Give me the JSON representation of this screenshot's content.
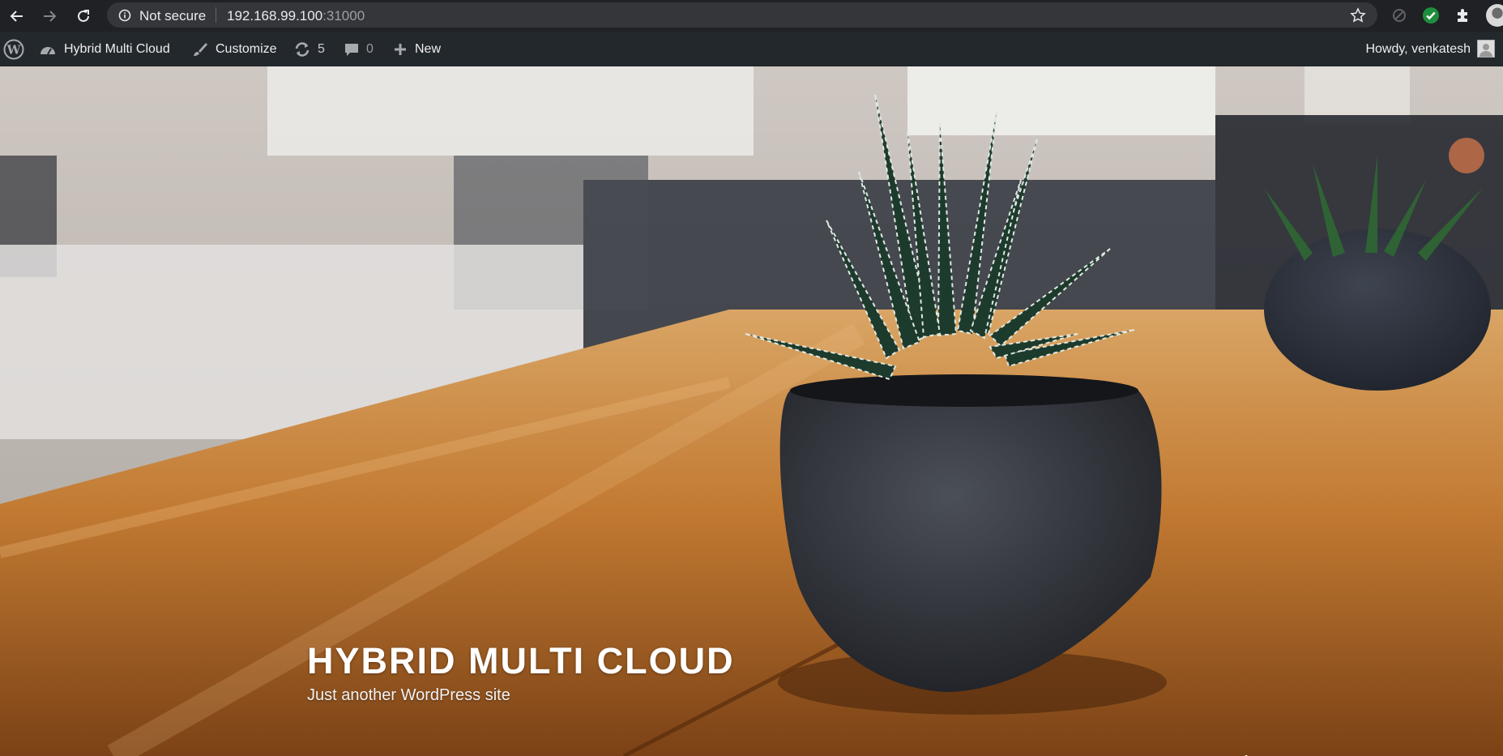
{
  "browser": {
    "security_status": "Not secure",
    "url_host": "192.168.99.100",
    "url_port": ":31000",
    "icons": [
      "back-icon",
      "forward-icon",
      "reload-icon",
      "info-icon",
      "star-icon",
      "extension-sync-icon",
      "extension-check-icon",
      "puzzle-icon",
      "profile-avatar"
    ]
  },
  "adminbar": {
    "wp_logo": "wordpress-logo-icon",
    "site_name": "Hybrid Multi Cloud",
    "customize": "Customize",
    "updates_count": "5",
    "comments_count": "0",
    "new_label": "New",
    "howdy": "Howdy, venkatesh"
  },
  "hero": {
    "site_title": "HYBRID MULTI CLOUD",
    "tagline": "Just another WordPress site",
    "scroll_icon": "arrow-down-icon"
  },
  "colors": {
    "chrome_bg": "#202124",
    "omnibox_bg": "#35363a",
    "adminbar_bg": "#23282d",
    "check_green": "#1e8e3e"
  }
}
